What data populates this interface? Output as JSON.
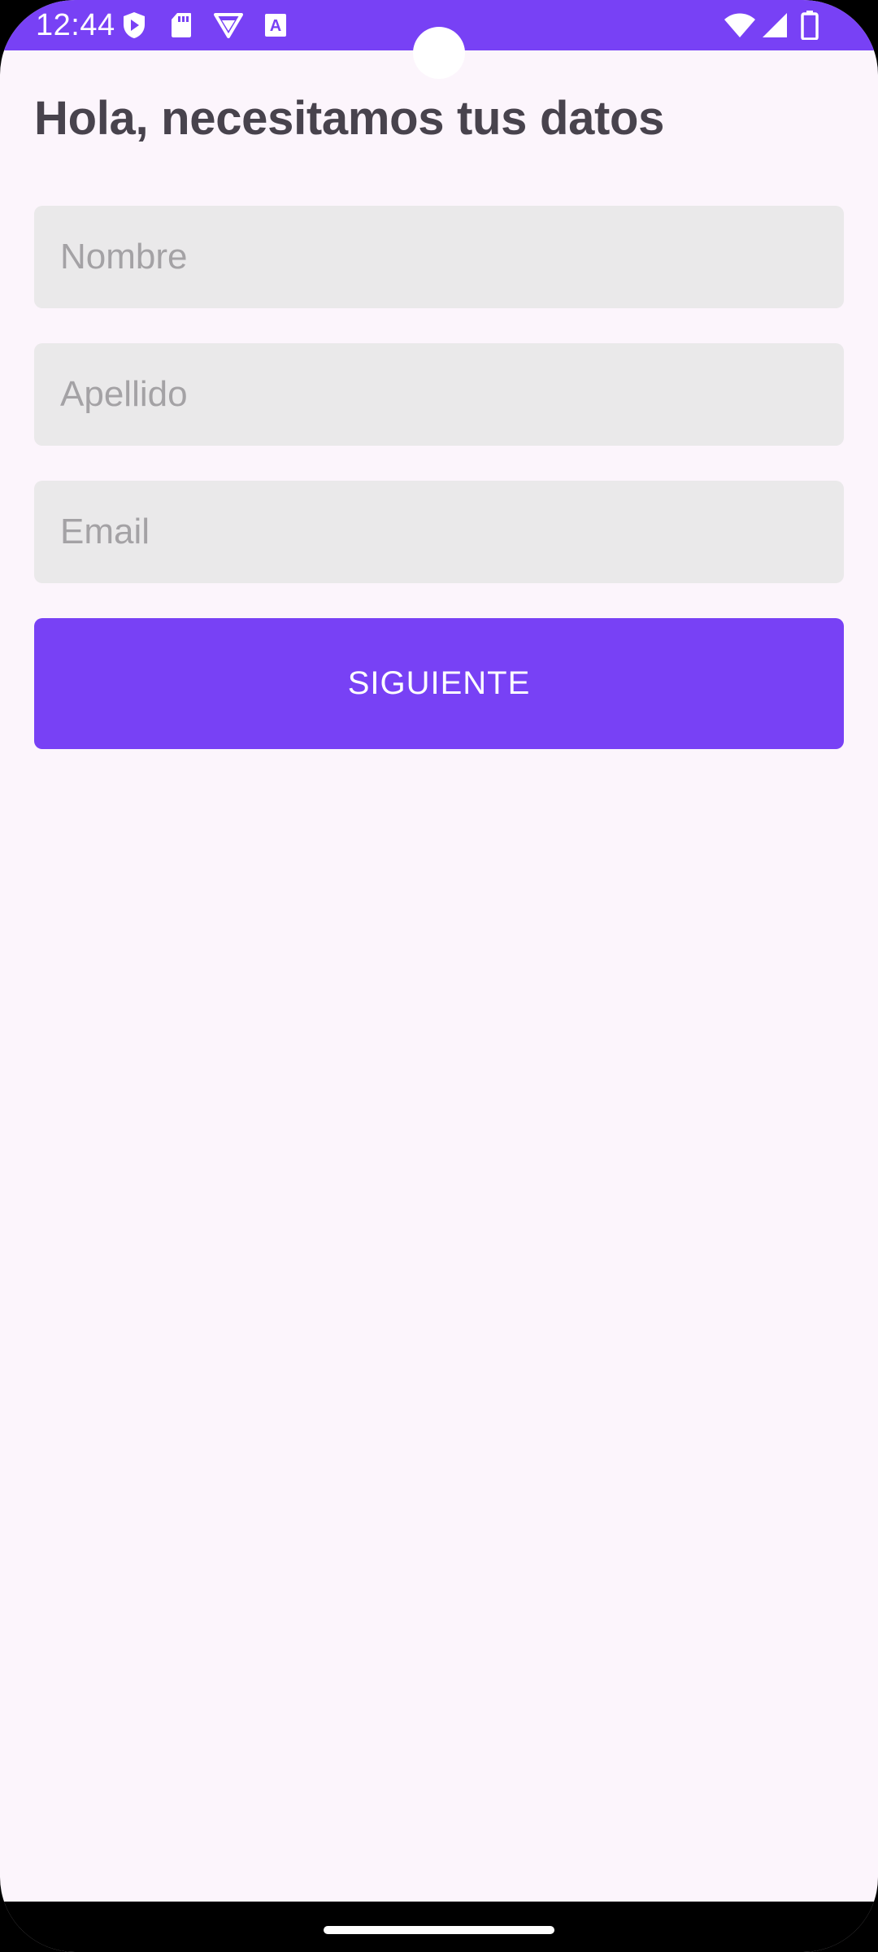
{
  "status_bar": {
    "time": "12:44",
    "background": "#7841f5",
    "left_icons": [
      "shield-play-icon",
      "sd-card-icon",
      "vpn-triangle-icon",
      "font-a-icon"
    ],
    "right_icons": [
      "wifi-icon",
      "signal-icon",
      "battery-icon"
    ]
  },
  "header": {
    "title": "Hola, necesitamos tus datos"
  },
  "form": {
    "nombre_placeholder": "Nombre",
    "apellido_placeholder": "Apellido",
    "email_placeholder": "Email",
    "submit_label": "SIGUIENTE"
  },
  "colors": {
    "accent": "#7841f5",
    "background": "#fcf5fc",
    "field_background": "#eae9ea",
    "title_text": "#48434d",
    "placeholder_text": "#a4a2a5"
  }
}
